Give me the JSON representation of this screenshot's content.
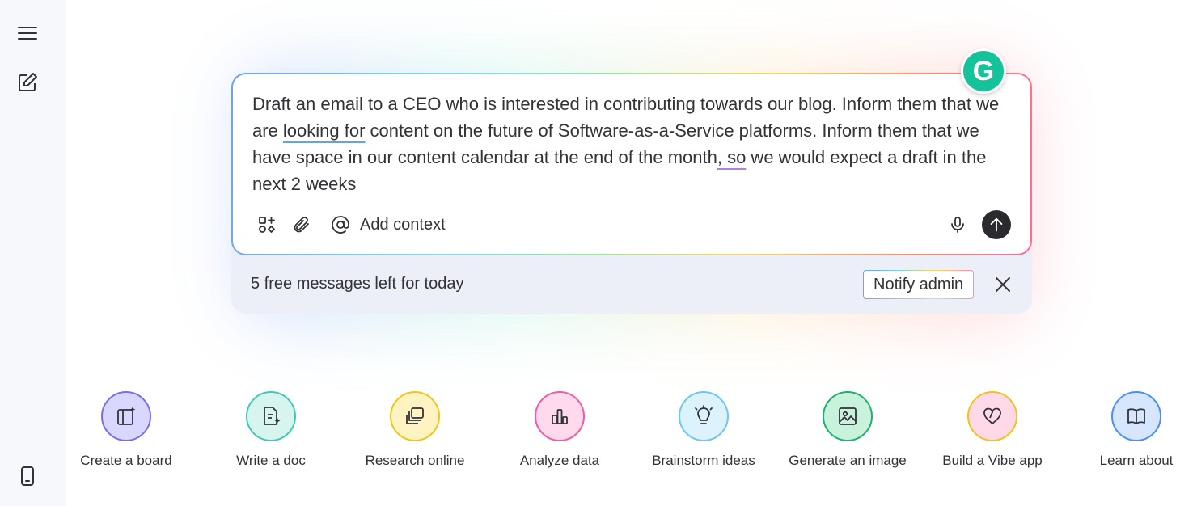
{
  "sidebar": {
    "menu_icon": "hamburger-menu-icon",
    "edit_icon": "edit-pencil-icon",
    "device_icon": "mobile-device-icon"
  },
  "prompt": {
    "text_parts": [
      "Draft an email to a CEO who is interested in contributing towards our blog. Inform them that we are ",
      "looking for",
      " content on the future of Software-as-a-Service platforms. Inform them that we have space in our content calendar at the end of the month",
      ", so",
      " we would expect a draft in the next 2 weeks"
    ],
    "add_context_label": "Add context",
    "icons": [
      "apps-plus-icon",
      "paperclip-icon",
      "at-sign-icon",
      "microphone-icon",
      "send-arrow-icon"
    ]
  },
  "grammarly": {
    "letter": "G",
    "color": "#15c39a"
  },
  "banner": {
    "free_messages": "5 free messages left for today",
    "notify_admin": "Notify admin"
  },
  "actions": [
    {
      "label": "Create a board",
      "icon": "board-sparkle-icon",
      "color": "#7b6cf0",
      "bg": "#d9d6ff"
    },
    {
      "label": "Write a doc",
      "icon": "doc-sparkle-icon",
      "color": "#3fc9b5",
      "bg": "#d6f5ee"
    },
    {
      "label": "Research online",
      "icon": "research-stack-icon",
      "color": "#f2c418",
      "bg": "#fff3c2"
    },
    {
      "label": "Analyze data",
      "icon": "bar-chart-icon",
      "color": "#f25aa5",
      "bg": "#ffd9ec"
    },
    {
      "label": "Brainstorm ideas",
      "icon": "lightbulb-icon",
      "color": "#6ec7f0",
      "bg": "#dcf2fc"
    },
    {
      "label": "Generate an image",
      "icon": "image-icon",
      "color": "#19b36b",
      "bg": "#c8f2dc"
    },
    {
      "label": "Build a Vibe app",
      "icon": "heart-icon",
      "color": "#f2c418",
      "bg": "#ffd9e8"
    },
    {
      "label": "Learn about",
      "icon": "book-icon",
      "color": "#4a8ff5",
      "bg": "#d6e6ff"
    }
  ]
}
